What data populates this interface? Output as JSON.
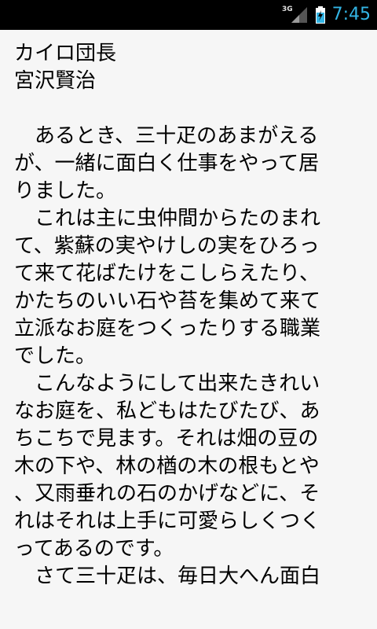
{
  "status_bar": {
    "network": "3G",
    "time": "7:45",
    "icons": [
      "signal-icon",
      "battery-charging-icon"
    ],
    "accent_color": "#33b5e5"
  },
  "document": {
    "title": "カイロ団長",
    "author": "宮沢賢治",
    "lines": [
      "　あるとき、三十疋のあまがえる",
      "が、一緒に面白く仕事をやって居",
      "りました。",
      "　これは主に虫仲間からたのまれ",
      "て、紫蘇の実やけしの実をひろっ",
      "て来て花ばたけをこしらえたり、",
      "かたちのいい石や苔を集めて来て",
      "立派なお庭をつくったりする職業",
      "でした。",
      "　こんなようにして出来たきれい",
      "なお庭を、私どもはたびたび、あ",
      "ちこちで見ます。それは畑の豆の",
      "木の下や、林の楢の木の根もとや",
      "、又雨垂れの石のかげなどに、そ",
      "れはそれは上手に可愛らしくつく",
      "ってあるのです。",
      "　さて三十疋は、毎日大へん面白"
    ]
  }
}
